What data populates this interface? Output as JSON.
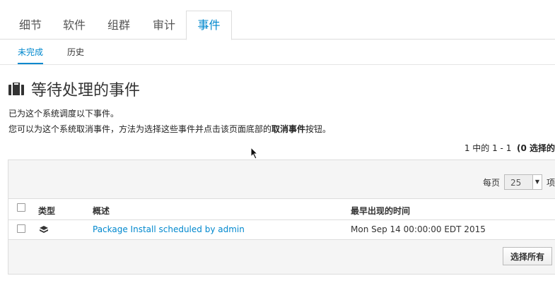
{
  "tabs": [
    "细节",
    "软件",
    "组群",
    "审计",
    "事件"
  ],
  "subtabs": [
    "未完成",
    "历史"
  ],
  "page_title": "等待处理的事件",
  "description": {
    "line1": "已为这个系统调度以下事件。",
    "line2_pre": "您可以为这个系统取消事件，方法为选择这些事件并点击该页面底部的",
    "line2_bold": "取消事件",
    "line2_post": "按钮。"
  },
  "pager": {
    "range": "1 中的 1 - 1",
    "selected": "(0 选择的"
  },
  "per_page": {
    "label": "每页",
    "value": "25",
    "suffix": "项"
  },
  "table": {
    "headers": [
      "类型",
      "概述",
      "最早出现的时间"
    ],
    "rows": [
      {
        "summary": "Package Install scheduled by admin",
        "time": "Mon Sep 14 00:00:00 EDT 2015"
      }
    ]
  },
  "select_all_label": "选择所有",
  "colors": {
    "accent": "#0088ce"
  }
}
